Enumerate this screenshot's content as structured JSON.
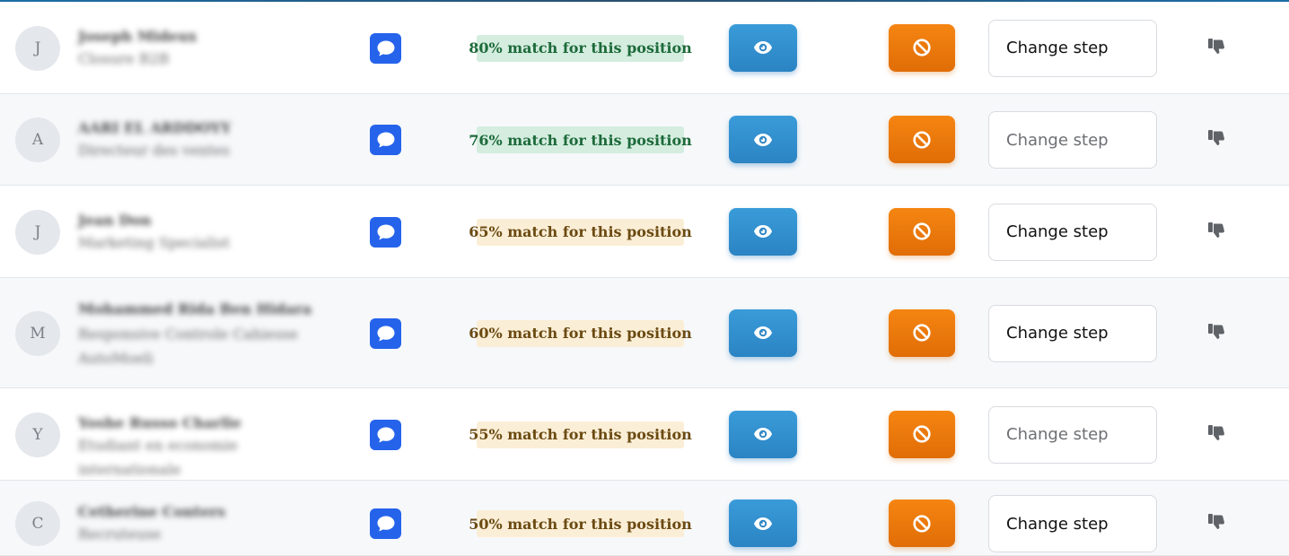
{
  "candidates": [
    {
      "initial": "J",
      "name": "Joseph Mideux",
      "role": [
        "Closure B2B"
      ],
      "match": "80% match for this position",
      "level": "green",
      "step": "Change step",
      "step_state": "dark"
    },
    {
      "initial": "A",
      "name": "AARI EL ARDDOYY",
      "role": [
        "Directeur des ventes"
      ],
      "match": "76% match for this position",
      "level": "green",
      "step": "Change step",
      "step_state": "muted"
    },
    {
      "initial": "J",
      "name": "Jean Don",
      "role": [
        "Marketing Specialist"
      ],
      "match": "65% match for this position",
      "level": "amber",
      "step": "Change step",
      "step_state": "dark"
    },
    {
      "initial": "M",
      "name": "Mohammed Rida Ben Hidara",
      "role": [
        "Responsive Controle Cahiesse",
        "AutoMoeli"
      ],
      "match": "60% match for this position",
      "level": "amber",
      "step": "Change step",
      "step_state": "dark"
    },
    {
      "initial": "Y",
      "name": "Yoshe Russo Charlie",
      "role": [
        "Etudiant en economie internationale"
      ],
      "match": "55% match for this position",
      "level": "amber",
      "step": "Change step",
      "step_state": "muted"
    },
    {
      "initial": "C",
      "name": "Cetherine Conters",
      "role": [
        "Recruteuse"
      ],
      "match": "50% match for this position",
      "level": "amber",
      "step": "Change step",
      "step_state": "dark"
    }
  ],
  "icons": {
    "chat": "chat-bubble-icon",
    "view": "eye-icon",
    "reject": "ban-icon",
    "dislike": "thumbs-down-icon"
  },
  "colors": {
    "chat_button": "#2563eb",
    "view_button": "#2f8fd0",
    "reject_button": "#ef7a0c",
    "match_high_bg": "#d4eddf",
    "match_mid_bg": "#fbeed6"
  }
}
